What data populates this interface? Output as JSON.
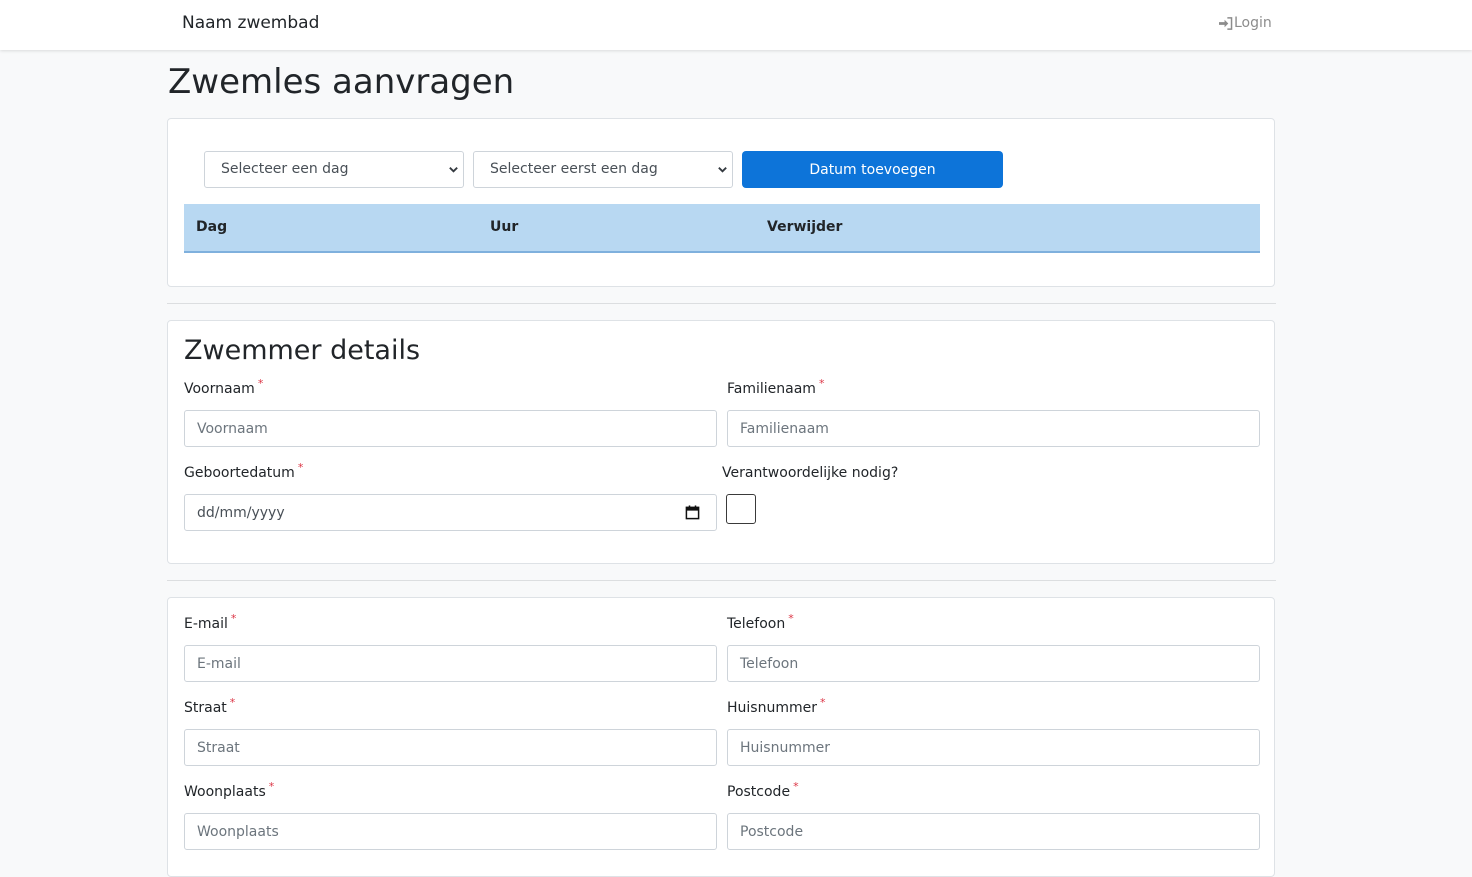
{
  "navbar": {
    "brand": "Naam zwembad",
    "login_label": "Login",
    "login_icon": "sign-in-icon"
  },
  "page": {
    "title": "Zwemles aanvragen"
  },
  "schedule": {
    "day_select": {
      "selected": "Selecteer een dag"
    },
    "hour_select": {
      "selected": "Selecteer eerst een dag"
    },
    "add_button_label": "Datum toevoegen",
    "table": {
      "headers": [
        "Dag",
        "Uur",
        "Verwijder"
      ],
      "rows": []
    }
  },
  "swimmer": {
    "title": "Zwemmer details",
    "required_marker": "*",
    "first_name": {
      "label": "Voornaam",
      "placeholder": "Voornaam"
    },
    "last_name": {
      "label": "Familienaam",
      "placeholder": "Familienaam"
    },
    "birthdate": {
      "label": "Geboortedatum",
      "value": "dd/mm/yyyy"
    },
    "guardian": {
      "label": "Verantwoordelijke nodig?",
      "checked": false
    }
  },
  "contact": {
    "email": {
      "label": "E-mail",
      "placeholder": "E-mail"
    },
    "phone": {
      "label": "Telefoon",
      "placeholder": "Telefoon"
    },
    "street": {
      "label": "Straat",
      "placeholder": "Straat"
    },
    "house_number": {
      "label": "Huisnummer",
      "placeholder": "Huisnummer"
    },
    "city": {
      "label": "Woonplaats",
      "placeholder": "Woonplaats"
    },
    "postcode": {
      "label": "Postcode",
      "placeholder": "Postcode"
    }
  },
  "colors": {
    "primary": "#0d74d9",
    "table_header": "#b8d8f2",
    "required": "#dc3545"
  }
}
